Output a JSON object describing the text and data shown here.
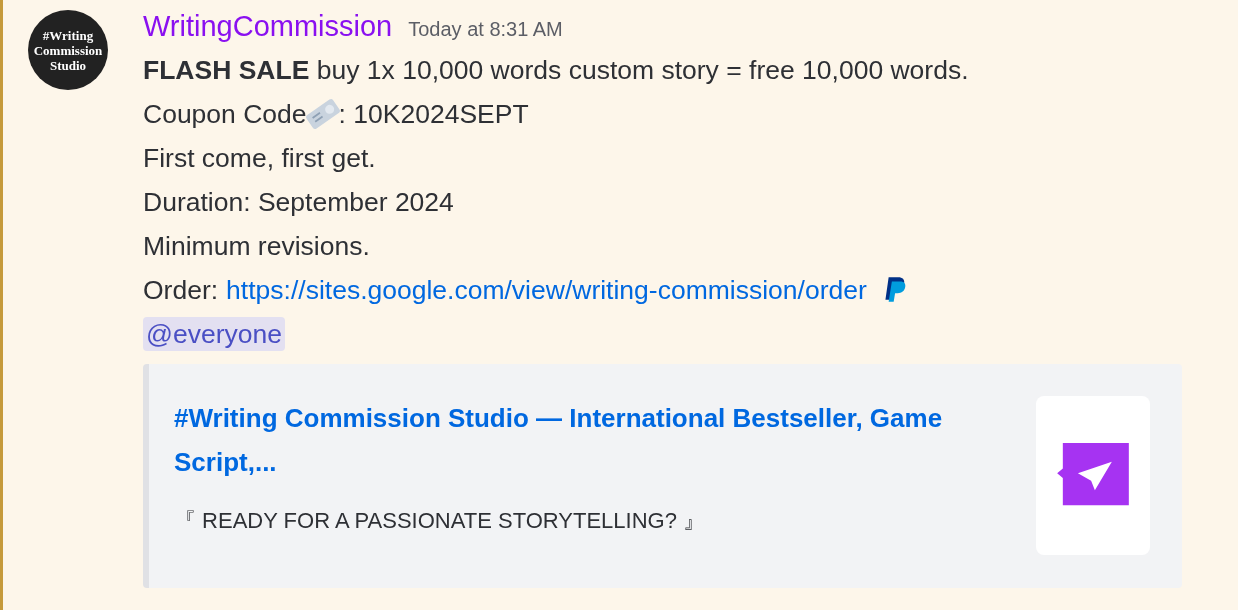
{
  "message": {
    "author": "WritingCommission",
    "timestamp": "Today at 8:31 AM",
    "avatar_text": [
      "#Writing",
      "Commission",
      "Studio"
    ],
    "lines": [
      {
        "kind": "text",
        "text": "**FLASH SALE** buy 1x 10,000 words custom story = free 10,000 words."
      },
      {
        "kind": "coupon",
        "label": "Coupon Code",
        "value": ": 10K2024SEPT"
      },
      {
        "kind": "text",
        "text": "First come, first get."
      },
      {
        "kind": "text",
        "text": "Duration: September 2024"
      },
      {
        "kind": "text",
        "text": "Minimum revisions."
      },
      {
        "kind": "link",
        "label": "Order:",
        "url": "https://sites.google.com/view/writing-commission/order"
      },
      {
        "kind": "mention",
        "text": "@everyone"
      }
    ],
    "embed": {
      "title": "#Writing Commission Studio — International Bestseller, Game Script,...",
      "description": "『 READY FOR A PASSIONATE STORYTELLING? 』"
    }
  }
}
